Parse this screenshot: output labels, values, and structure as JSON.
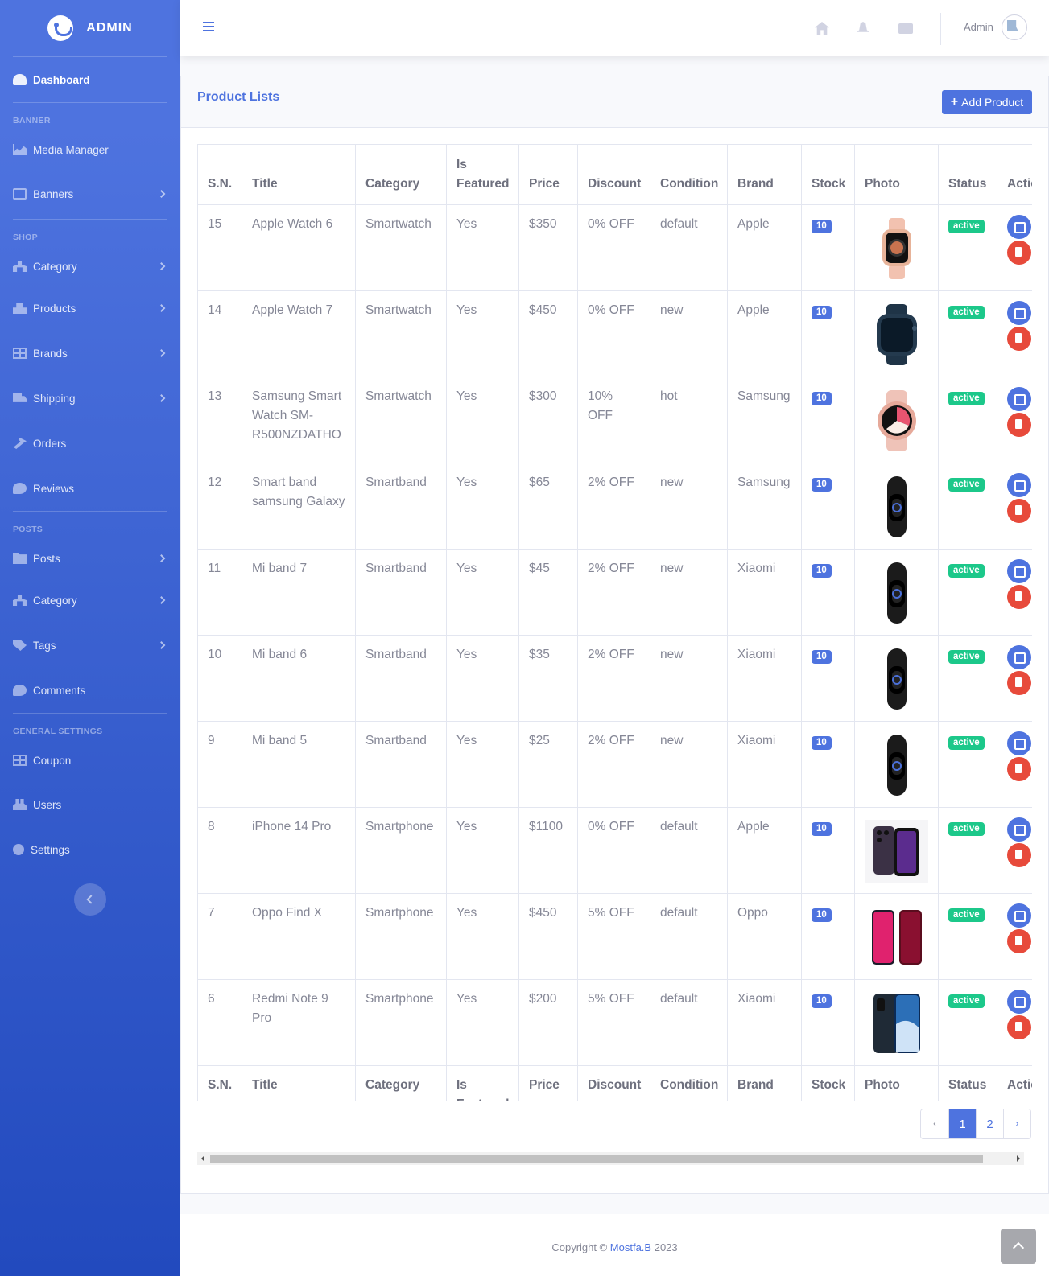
{
  "brand": {
    "name": "ADMIN"
  },
  "sidebar": {
    "dashboard": "Dashboard",
    "sections": {
      "banner": "BANNER",
      "shop": "SHOP",
      "posts": "POSTS",
      "general": "GENERAL SETTINGS"
    },
    "items": {
      "media": "Media Manager",
      "banners": "Banners",
      "shop_category": "Category",
      "products": "Products",
      "brands": "Brands",
      "shipping": "Shipping",
      "orders": "Orders",
      "reviews": "Reviews",
      "posts": "Posts",
      "post_category": "Category",
      "tags": "Tags",
      "comments": "Comments",
      "coupon": "Coupon",
      "users": "Users",
      "settings": "Settings"
    }
  },
  "topbar": {
    "user_name": "Admin"
  },
  "page": {
    "title": "Product Lists",
    "add_button": "Add Product"
  },
  "table": {
    "headers": [
      "S.N.",
      "Title",
      "Category",
      "Is Featured",
      "Price",
      "Discount",
      "Condition",
      "Brand",
      "Stock",
      "Photo",
      "Status",
      "Action"
    ],
    "rows": [
      {
        "sn": "15",
        "title": "Apple Watch 6",
        "category": "Smartwatch",
        "featured": "Yes",
        "price": "$350",
        "discount": "0% OFF",
        "condition": "default",
        "brand": "Apple",
        "stock": "10",
        "status": "active",
        "photo": "watch-rosegold"
      },
      {
        "sn": "14",
        "title": "Apple Watch 7",
        "category": "Smartwatch",
        "featured": "Yes",
        "price": "$450",
        "discount": "0% OFF",
        "condition": "new",
        "brand": "Apple",
        "stock": "10",
        "status": "active",
        "photo": "watch-navy"
      },
      {
        "sn": "13",
        "title": "Samsung Smart Watch SM-R500NZDATHO",
        "category": "Smartwatch",
        "featured": "Yes",
        "price": "$300",
        "discount": "10% OFF",
        "condition": "hot",
        "brand": "Samsung",
        "stock": "10",
        "status": "active",
        "photo": "watch-pink-round"
      },
      {
        "sn": "12",
        "title": "Smart band samsung Galaxy",
        "category": "Smartband",
        "featured": "Yes",
        "price": "$65",
        "discount": "2% OFF",
        "condition": "new",
        "brand": "Samsung",
        "stock": "10",
        "status": "active",
        "photo": "band-black"
      },
      {
        "sn": "11",
        "title": "Mi band 7",
        "category": "Smartband",
        "featured": "Yes",
        "price": "$45",
        "discount": "2% OFF",
        "condition": "new",
        "brand": "Xiaomi",
        "stock": "10",
        "status": "active",
        "photo": "band-black"
      },
      {
        "sn": "10",
        "title": "Mi band 6",
        "category": "Smartband",
        "featured": "Yes",
        "price": "$35",
        "discount": "2% OFF",
        "condition": "new",
        "brand": "Xiaomi",
        "stock": "10",
        "status": "active",
        "photo": "band-black"
      },
      {
        "sn": "9",
        "title": "Mi band 5",
        "category": "Smartband",
        "featured": "Yes",
        "price": "$25",
        "discount": "2% OFF",
        "condition": "new",
        "brand": "Xiaomi",
        "stock": "10",
        "status": "active",
        "photo": "band-black"
      },
      {
        "sn": "8",
        "title": "iPhone 14 Pro",
        "category": "Smartphone",
        "featured": "Yes",
        "price": "$1100",
        "discount": "0% OFF",
        "condition": "default",
        "brand": "Apple",
        "stock": "10",
        "status": "active",
        "photo": "phone-purple"
      },
      {
        "sn": "7",
        "title": "Oppo Find X",
        "category": "Smartphone",
        "featured": "Yes",
        "price": "$450",
        "discount": "5% OFF",
        "condition": "default",
        "brand": "Oppo",
        "stock": "10",
        "status": "active",
        "photo": "phone-red"
      },
      {
        "sn": "6",
        "title": "Redmi Note 9 Pro",
        "category": "Smartphone",
        "featured": "Yes",
        "price": "$200",
        "discount": "5% OFF",
        "condition": "default",
        "brand": "Xiaomi",
        "stock": "10",
        "status": "active",
        "photo": "phone-blue"
      }
    ]
  },
  "pagination": {
    "prev": "‹",
    "pages": [
      "1",
      "2"
    ],
    "current": "1",
    "next": "›"
  },
  "footer": {
    "copyright": "Copyright ©",
    "author": "Mostfa.B",
    "year": "2023"
  },
  "colors": {
    "primary": "#4e73df",
    "success": "#1cc88a",
    "danger": "#e74a3b"
  }
}
